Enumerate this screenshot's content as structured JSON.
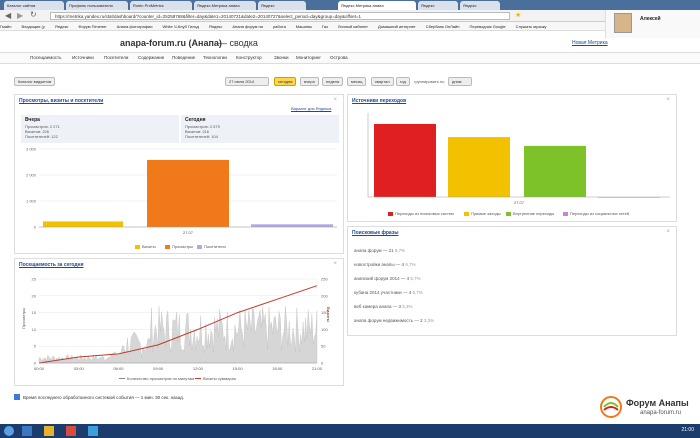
{
  "browser": {
    "tabs": [
      "Каталог сайтов",
      "Профиль пользователя",
      "Rubin ProMetrics",
      "Яндекс.Метрика анапа",
      "Яндекс",
      "Яндекс.Метрика анапа",
      "Яндекс",
      "Яндекс"
    ],
    "url": "https://metrika.yandex.ru/stat/dashboard/?counter_id=25258768&filter=day&date1=20140721&date2=20140727&select_period=day&group=day&offset=1",
    "bookmarks": [
      "Гмайл",
      "Входящие (у",
      "Яндекс",
      "Форум Печенег",
      "Анапа фотографии",
      "White Ч-Клуб Гильд",
      "Яндекс",
      "Анапа форум на",
      "работа",
      "Машины",
      "Газ",
      "Личный кабинет",
      "Домашний интернет",
      "Сбербанк ОнЛайн",
      "Переводчик Google",
      "Слушать музыку"
    ],
    "profile_name": "Алексей"
  },
  "header": {
    "site": "anapa-forum.ru (Анапа)",
    "suffix": "— сводка",
    "new_metrika": "Новая Метрика"
  },
  "nav": [
    "Посещаемость",
    "Источники",
    "Посетители",
    "Содержание",
    "Поведение",
    "Технологии",
    "Конструктор",
    "Звонки",
    "Мониторинг",
    "Острова"
  ],
  "toolbar": {
    "catalog": "Каталог виджетов",
    "date": "27 июля 2014",
    "periods": [
      "сегодня",
      "вчера",
      "неделя",
      "месяц",
      "квартал",
      "год"
    ],
    "group_label": "группировать по",
    "group_value": "дням"
  },
  "visits_card": {
    "title": "Просмотры, визиты и посетители",
    "variant_link": "Вариант для Яндекса",
    "yesterday": {
      "label": "Вчера",
      "views": "Просмотров: 2 271",
      "visits": "Визитов: 226",
      "visitors": "Посетителей: 122"
    },
    "today": {
      "label": "Сегодня",
      "views": "Просмотров: 2 579",
      "visits": "Визитов: 216",
      "visitors": "Посетителей: 104"
    },
    "legend": [
      "Визиты",
      "Просмотры",
      "Посетители"
    ],
    "colors": [
      "#f2c200",
      "#f07a1a",
      "#b3a8e0"
    ]
  },
  "sources_card": {
    "title": "Источники переходов",
    "legend": [
      "Переходы из поисковых систем",
      "Прямые заходы",
      "Внутренние переходы",
      "Переходы из социальных сетей"
    ],
    "colors": [
      "#e02020",
      "#f2c200",
      "#7ec22a",
      "#c488d0"
    ]
  },
  "traffic_card": {
    "title": "Посещаемость за сегодня",
    "left_label": "Просмотры",
    "right_label": "Визиты",
    "legend": [
      "Количество просмотров по минутам",
      "Визиты суммарно"
    ]
  },
  "phrases_card": {
    "title": "Поисковые фразы",
    "items": [
      {
        "text": "анапа форум — 21",
        "pct": "9,7%"
      },
      {
        "text": "новостройки анапы — 4",
        "pct": "6,7%"
      },
      {
        "text": "анапский форум 2014 — 4",
        "pct": "6,7%"
      },
      {
        "text": "кубана 2014 участники — 4",
        "pct": "6,7%"
      },
      {
        "text": "веб камера анапа — 3",
        "pct": "5,3%"
      },
      {
        "text": "анапа форум недвижимость — 2",
        "pct": "3,3%"
      }
    ]
  },
  "status": "Время последнего обработанного системой события — 1 мин. 30 сек. назад.",
  "watermark": {
    "brand": "Форум Анапы",
    "site": "anapa-forum.ru"
  },
  "taskbar": {
    "clock": "21:00"
  },
  "chart_data": [
    {
      "type": "bar",
      "categories": [
        "27.07"
      ],
      "series": [
        {
          "name": "Визиты",
          "values": [
            216
          ]
        },
        {
          "name": "Просмотры",
          "values": [
            2579
          ]
        },
        {
          "name": "Посетители",
          "values": [
            104
          ]
        }
      ],
      "yticks": [
        0,
        1000,
        2000,
        3000
      ],
      "xlabel": "27.07",
      "ylim": [
        0,
        3000
      ]
    },
    {
      "type": "bar",
      "categories": [
        "27.07"
      ],
      "series": [
        {
          "name": "Переходы из поисковых систем",
          "values": [
            100
          ]
        },
        {
          "name": "Прямые заходы",
          "values": [
            82
          ]
        },
        {
          "name": "Внутренние переходы",
          "values": [
            70
          ]
        },
        {
          "name": "Переходы из социальных сетей",
          "values": [
            0
          ]
        }
      ],
      "xlabel": "27.07",
      "ylim": [
        0,
        115
      ]
    },
    {
      "type": "line",
      "x": [
        "00:00",
        "03:00",
        "06:00",
        "09:00",
        "12:00",
        "15:00",
        "18:00",
        "21:00"
      ],
      "series": [
        {
          "name": "Визиты суммарно",
          "values": [
            0,
            18,
            27,
            54,
            100,
            150,
            190,
            230
          ]
        }
      ],
      "y_left_ticks": [
        0,
        5,
        10,
        15,
        20,
        25
      ],
      "y_right_ticks": [
        0,
        50,
        100,
        150,
        200,
        250
      ],
      "ylim_left": [
        0,
        25
      ],
      "ylim_right": [
        0,
        250
      ]
    }
  ]
}
